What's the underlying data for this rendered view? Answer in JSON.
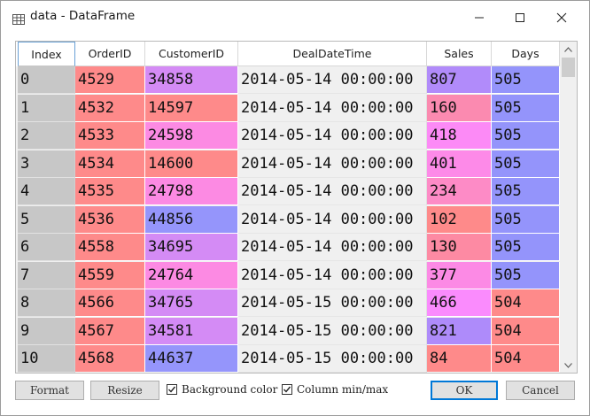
{
  "window": {
    "title": "data - DataFrame",
    "icons": {
      "app": "table-grid-icon",
      "minimize": "minimize-icon",
      "maximize": "maximize-icon",
      "close": "close-icon"
    }
  },
  "table": {
    "columns": [
      "Index",
      "OrderID",
      "CustomerID",
      "DealDateTime",
      "Sales",
      "Days"
    ],
    "rows": [
      {
        "index": "0",
        "order_id": "4529",
        "customer_id": "34858",
        "deal_datetime": "2014-05-14 00:00:00",
        "sales": "807",
        "days": "505"
      },
      {
        "index": "1",
        "order_id": "4532",
        "customer_id": "14597",
        "deal_datetime": "2014-05-14 00:00:00",
        "sales": "160",
        "days": "505"
      },
      {
        "index": "2",
        "order_id": "4533",
        "customer_id": "24598",
        "deal_datetime": "2014-05-14 00:00:00",
        "sales": "418",
        "days": "505"
      },
      {
        "index": "3",
        "order_id": "4534",
        "customer_id": "14600",
        "deal_datetime": "2014-05-14 00:00:00",
        "sales": "401",
        "days": "505"
      },
      {
        "index": "4",
        "order_id": "4535",
        "customer_id": "24798",
        "deal_datetime": "2014-05-14 00:00:00",
        "sales": "234",
        "days": "505"
      },
      {
        "index": "5",
        "order_id": "4536",
        "customer_id": "44856",
        "deal_datetime": "2014-05-14 00:00:00",
        "sales": "102",
        "days": "505"
      },
      {
        "index": "6",
        "order_id": "4558",
        "customer_id": "34695",
        "deal_datetime": "2014-05-14 00:00:00",
        "sales": "130",
        "days": "505"
      },
      {
        "index": "7",
        "order_id": "4559",
        "customer_id": "24764",
        "deal_datetime": "2014-05-14 00:00:00",
        "sales": "377",
        "days": "505"
      },
      {
        "index": "8",
        "order_id": "4566",
        "customer_id": "34765",
        "deal_datetime": "2014-05-15 00:00:00",
        "sales": "466",
        "days": "504"
      },
      {
        "index": "9",
        "order_id": "4567",
        "customer_id": "34581",
        "deal_datetime": "2014-05-15 00:00:00",
        "sales": "821",
        "days": "504"
      },
      {
        "index": "10",
        "order_id": "4568",
        "customer_id": "44637",
        "deal_datetime": "2014-05-15 00:00:00",
        "sales": "84",
        "days": "504"
      }
    ],
    "cell_colors": {
      "order_id": [
        "#fe8a8a",
        "#fe8a8a",
        "#fe8a8a",
        "#fe8a8a",
        "#fe8a8a",
        "#fe8a8a",
        "#fe8a8a",
        "#fe8a8a",
        "#fe8a8a",
        "#fe8a8a",
        "#fe8a8a"
      ],
      "customer_id": [
        "#d48bf5",
        "#fe8a8a",
        "#fc8ae3",
        "#fe8a8a",
        "#fc8ae3",
        "#9595fb",
        "#d48bf5",
        "#fc8ae3",
        "#d48bf5",
        "#d48bf5",
        "#9595fb"
      ],
      "sales": [
        "#b18bfa",
        "#fb8ab0",
        "#fc8af6",
        "#fd8ae8",
        "#fd8bc6",
        "#fe8a8a",
        "#fd8aa3",
        "#fc8ae5",
        "#fa8bfd",
        "#ae8bfa",
        "#fe8a8a"
      ],
      "days": [
        "#9494fb",
        "#9494fb",
        "#9494fb",
        "#9494fb",
        "#9494fb",
        "#9494fb",
        "#9494fb",
        "#9494fb",
        "#fe8a8a",
        "#fe8a8a",
        "#fe8a8a"
      ]
    }
  },
  "scrollbar": {
    "up_icon": "chevron-up-icon",
    "down_icon": "chevron-down-icon"
  },
  "footer": {
    "format_label": "Format",
    "resize_label": "Resize",
    "background_color_label": "Background color",
    "background_color_checked": true,
    "column_minmax_label": "Column min/max",
    "column_minmax_checked": true,
    "ok_label": "OK",
    "cancel_label": "Cancel"
  }
}
